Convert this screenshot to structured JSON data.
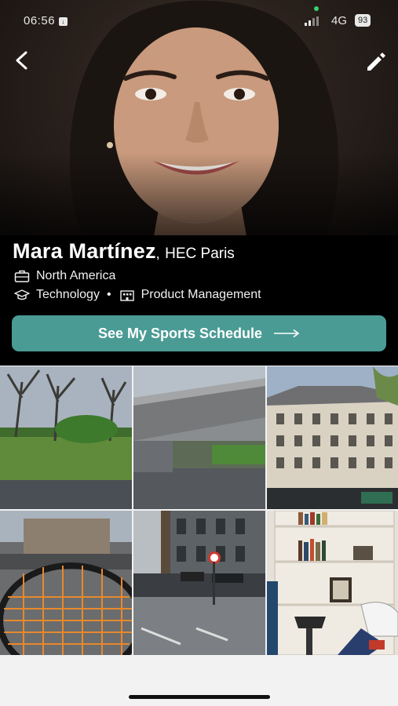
{
  "status_bar": {
    "time": "06:56",
    "time_badge": "↓",
    "network": "4G",
    "battery": "93"
  },
  "profile": {
    "name": "Mara Martínez",
    "separator": ",",
    "school": "HEC Paris",
    "region": "North America",
    "industry": "Technology",
    "bullet": "•",
    "function": "Product Management"
  },
  "cta": {
    "label": "See My Sports Schedule"
  },
  "icons": {
    "back": "back-arrow-icon",
    "edit": "pencil-icon",
    "region": "briefcase-icon",
    "industry": "graduation-cap-icon",
    "function": "building-icon",
    "cta_arrow": "long-arrow-right-icon"
  },
  "colors": {
    "accent": "#4b9b95",
    "panel": "#000000",
    "bottom_bar": "#f2f2f2"
  },
  "photos": [
    "park-trees",
    "bridge-street",
    "paris-building",
    "tennis-racket",
    "city-street",
    "bookshelf-bike"
  ]
}
